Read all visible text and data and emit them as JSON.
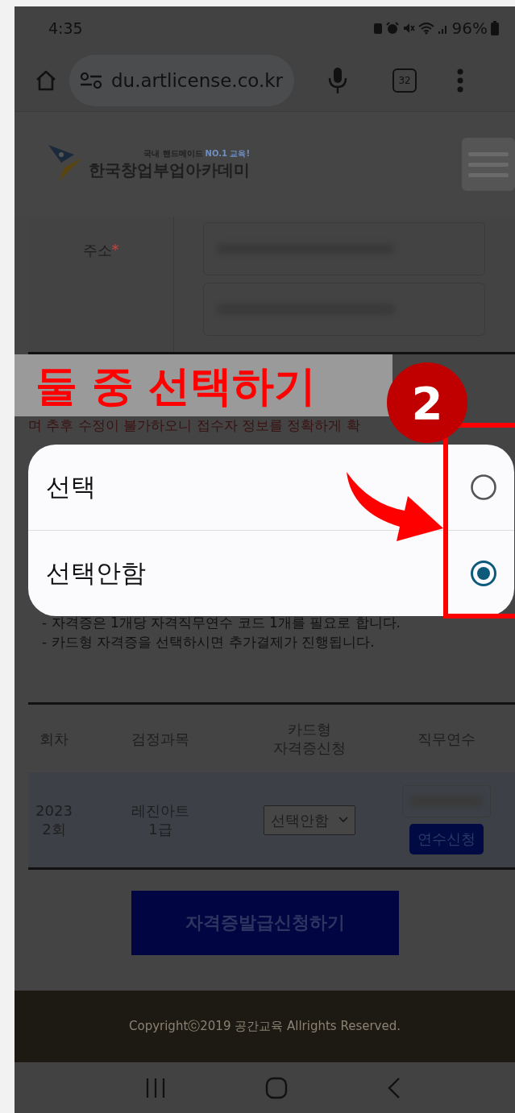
{
  "status_bar": {
    "time": "4:35",
    "battery": "96%"
  },
  "browser": {
    "url": "du.artlicense.co.kr",
    "tab_count": "32"
  },
  "site_header": {
    "tagline_prefix": "국내 핸드메이드",
    "tagline_highlight": "NO.1 교육!",
    "logo_text": "한국창업부업아카데미"
  },
  "address": {
    "label": "주소",
    "required_mark": "*"
  },
  "annotation": {
    "title": "둘 중 선택하기",
    "step": "2"
  },
  "notice": "며 추후 수정이 불가하오니 접수자 정보를 정확하게 확",
  "dialog": {
    "options": [
      {
        "label": "선택",
        "selected": false
      },
      {
        "label": "선택안함",
        "selected": true
      }
    ]
  },
  "notes": [
    "- 자격증은 1개당 자격직무연수 코드 1개를 필요로 합니다.",
    "- 카드형 자격증을 선택하시면 추가결제가 진행됩니다."
  ],
  "table": {
    "columns": [
      "회차",
      "검정과목",
      "카드형\n자격증신청",
      "직무연수"
    ],
    "rows": [
      {
        "round": "2023\n2회",
        "subject": "레진아트\n1급",
        "card_select": "선택안함",
        "training_button": "연수신청"
      }
    ]
  },
  "submit_button": "자격증발급신청하기",
  "footer": "Copyrightⓒ2019 공간교육 Allrights Reserved."
}
